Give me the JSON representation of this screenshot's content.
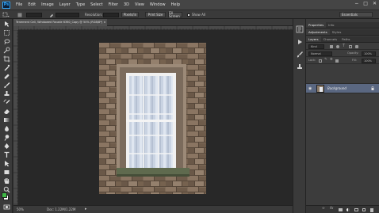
{
  "app": {
    "logo": "Ps"
  },
  "menu": [
    "File",
    "Edit",
    "Image",
    "Layer",
    "Type",
    "Select",
    "Filter",
    "3D",
    "View",
    "Window",
    "Help"
  ],
  "window_controls": {
    "minimize": "−",
    "maximize": "□",
    "close": "✕"
  },
  "options": {
    "feather_value": "0 px",
    "antialias_label": "Anti-alias",
    "mode_label": "Normal",
    "width_label": "Width:",
    "height_label": "Height:",
    "refine_edge": "Refine Edge...",
    "print_size": "Print Size",
    "fill_screen": "Fill Screen",
    "resolution_label": "Resolution:",
    "resample_check": "Show All",
    "workspace": "Essentials"
  },
  "document": {
    "tab_title": "Tenement Cell, Windowed Facade 6360_Copy @ 50% (RGB/8*)",
    "close": "×"
  },
  "status": {
    "zoom": "50%",
    "doc_size": "Doc: 1.22M/1.22M"
  },
  "panels": {
    "group1_tabs": [
      "Properties",
      "Info"
    ],
    "group2_tabs": [
      "Adjustments",
      "Styles"
    ],
    "layers_tabs": [
      "Layers",
      "Channels",
      "Paths"
    ],
    "kind_label": "Kind",
    "blend_mode": "Normal",
    "opacity_label": "Opacity:",
    "opacity_value": "100%",
    "lock_label": "Lock:",
    "fill_label": "Fill:",
    "fill_value": "100%",
    "layer_name": "Background"
  },
  "colors": {
    "accent": "#5a6781",
    "foreground_swatch": "#3fb946",
    "background_swatch": "#ffffff"
  }
}
